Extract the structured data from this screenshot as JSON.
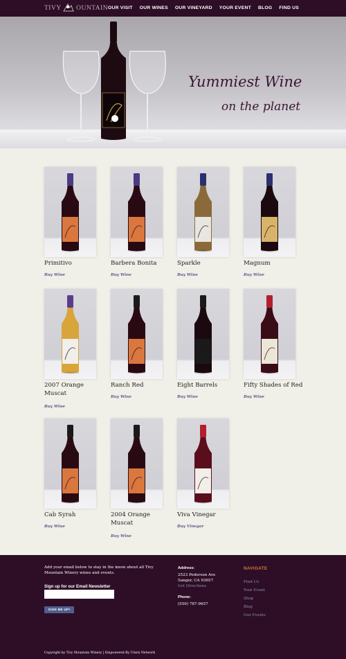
{
  "header": {
    "logo_text_left": "TIVY",
    "logo_text_right": "OUNTAIN",
    "nav": [
      "OUR VISIT",
      "OUR WINES",
      "OUR VINEYARD",
      "YOUR EVENT",
      "BLOG",
      "FIND US"
    ]
  },
  "hero": {
    "line1": "Yummiest Wine",
    "line2": "on the planet"
  },
  "products": [
    {
      "name": "Primitivo",
      "link": "Buy Wine",
      "label_color": "#d9773f",
      "cap_color": "#4a3b82",
      "glass": "#2a0a12"
    },
    {
      "name": "Barbera Bonita",
      "link": "Buy Wine",
      "label_color": "#d9773f",
      "cap_color": "#4a3b82",
      "glass": "#2a0a12"
    },
    {
      "name": "Sparkle",
      "link": "Buy Wine",
      "label_color": "#e8e6e2",
      "cap_color": "#2b2f6e",
      "glass": "#8a6a3a"
    },
    {
      "name": "Magnum",
      "link": "Buy Wine",
      "label_color": "#d8b36a",
      "cap_color": "#2b2f6e",
      "glass": "#1a0a10"
    },
    {
      "name": "2007 Orange Muscat",
      "link": "Buy Wine",
      "label_color": "#f0efe9",
      "cap_color": "#5a3d8a",
      "glass": "#d8a53a"
    },
    {
      "name": "Ranch Red",
      "link": "Buy Wine",
      "label_color": "#d9773f",
      "cap_color": "#1a1a1a",
      "glass": "#2a0a12"
    },
    {
      "name": "Eight Barrels",
      "link": "Buy Wine",
      "label_color": "#1a1a1a",
      "cap_color": "#1a1a1a",
      "glass": "#1a0a10"
    },
    {
      "name": "Fifty Shades of Red",
      "link": "Buy Wine",
      "label_color": "#ece6d6",
      "cap_color": "#b21e2e",
      "glass": "#3a0c16"
    },
    {
      "name": "Cab Syrah",
      "link": "Buy Wine",
      "label_color": "#d9773f",
      "cap_color": "#1a1a1a",
      "glass": "#2a0a12"
    },
    {
      "name": "2004 Orange Muscat",
      "link": "Buy Wine",
      "label_color": "#d9773f",
      "cap_color": "#1a1a1a",
      "glass": "#2a0a12"
    },
    {
      "name": "Viva Vinegar",
      "link": "Buy Vinegar",
      "label_color": "#f2efe9",
      "cap_color": "#b21e2e",
      "glass": "#5a0e1c"
    }
  ],
  "footer": {
    "intro": "Add your email below to stay in the know about all Tivy Mountain Winery wines and events.",
    "newsletter_title": "Sign up for our Email Newsletter",
    "signup_button": "SIGN ME UP!",
    "address_heading": "Address:",
    "address_line1": "2523 Pederson Ave",
    "address_line2": "Sanger, CA 93657",
    "directions_link": "Get Directions",
    "phone_heading": "Phone:",
    "phone": "(559) 787-9657",
    "nav_title": "NAVIGATE",
    "nav_items": [
      "Find Us",
      "Your Event",
      "Shop",
      "Blog",
      "Our Events"
    ],
    "copyright": "Copyright by Tivy Mountain Winery | Empowered By Uturn Network"
  }
}
